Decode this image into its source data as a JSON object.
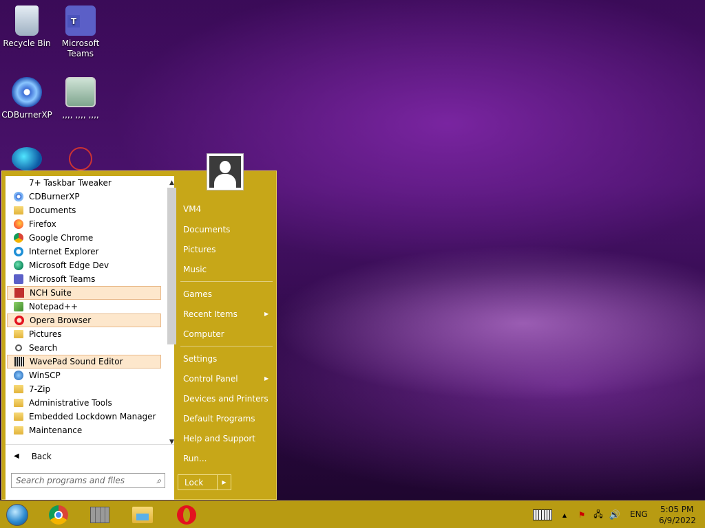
{
  "desktop": {
    "icons": [
      {
        "label": "Recycle Bin",
        "icon": "recycle-bin-icon"
      },
      {
        "label": "Microsoft Teams",
        "icon": "teams-icon"
      },
      {
        "label": "CDBurnerXP",
        "icon": "cdburner-icon"
      },
      {
        "label": ",,,, ,,,, ,,,,",
        "icon": "user-shortcut-icon"
      },
      {
        "label": "",
        "icon": "edge-icon"
      },
      {
        "label": "",
        "icon": "app-icon"
      }
    ]
  },
  "start_menu": {
    "programs": [
      {
        "label": "7+ Taskbar Tweaker",
        "icon": "tweaker-icon",
        "highlighted": false
      },
      {
        "label": "CDBurnerXP",
        "icon": "cdburner-icon",
        "highlighted": false
      },
      {
        "label": "Documents",
        "icon": "folder-icon",
        "highlighted": false
      },
      {
        "label": "Firefox",
        "icon": "firefox-icon",
        "highlighted": false
      },
      {
        "label": "Google Chrome",
        "icon": "chrome-icon",
        "highlighted": false
      },
      {
        "label": "Internet Explorer",
        "icon": "ie-icon",
        "highlighted": false
      },
      {
        "label": "Microsoft Edge Dev",
        "icon": "edge-dev-icon",
        "highlighted": false
      },
      {
        "label": "Microsoft Teams",
        "icon": "teams-icon",
        "highlighted": false
      },
      {
        "label": "NCH Suite",
        "icon": "nch-icon",
        "highlighted": true
      },
      {
        "label": "Notepad++",
        "icon": "notepadpp-icon",
        "highlighted": false
      },
      {
        "label": "Opera Browser",
        "icon": "opera-icon",
        "highlighted": true
      },
      {
        "label": "Pictures",
        "icon": "folder-icon",
        "highlighted": false
      },
      {
        "label": "Search",
        "icon": "search-icon",
        "highlighted": false
      },
      {
        "label": "WavePad Sound Editor",
        "icon": "wavepad-icon",
        "highlighted": true
      },
      {
        "label": "WinSCP",
        "icon": "winscp-icon",
        "highlighted": false
      },
      {
        "label": "7-Zip",
        "icon": "folder-icon",
        "highlighted": false
      },
      {
        "label": "Administrative Tools",
        "icon": "folder-icon",
        "highlighted": false
      },
      {
        "label": "Embedded Lockdown Manager",
        "icon": "folder-icon",
        "highlighted": false
      },
      {
        "label": "Maintenance",
        "icon": "folder-icon",
        "highlighted": false
      }
    ],
    "back_label": "Back",
    "search_placeholder": "Search programs and files",
    "right_items": {
      "user": "VM4",
      "documents": "Documents",
      "pictures": "Pictures",
      "music": "Music",
      "games": "Games",
      "recent_items": "Recent Items",
      "computer": "Computer",
      "settings": "Settings",
      "control_panel": "Control Panel",
      "devices_printers": "Devices and Printers",
      "default_programs": "Default Programs",
      "help_support": "Help and Support",
      "run": "Run..."
    },
    "lock_label": "Lock"
  },
  "taskbar": {
    "pinned": [
      "start-orb-icon",
      "chrome-icon",
      "app-grid-icon",
      "file-explorer-icon",
      "opera-icon"
    ],
    "tray": {
      "language": "ENG",
      "time": "5:05 PM",
      "date": "6/9/2022"
    }
  },
  "colors": {
    "menu_bg": "#c7a718",
    "taskbar_bg": "#b89b12",
    "highlight": "#fde7cc"
  }
}
